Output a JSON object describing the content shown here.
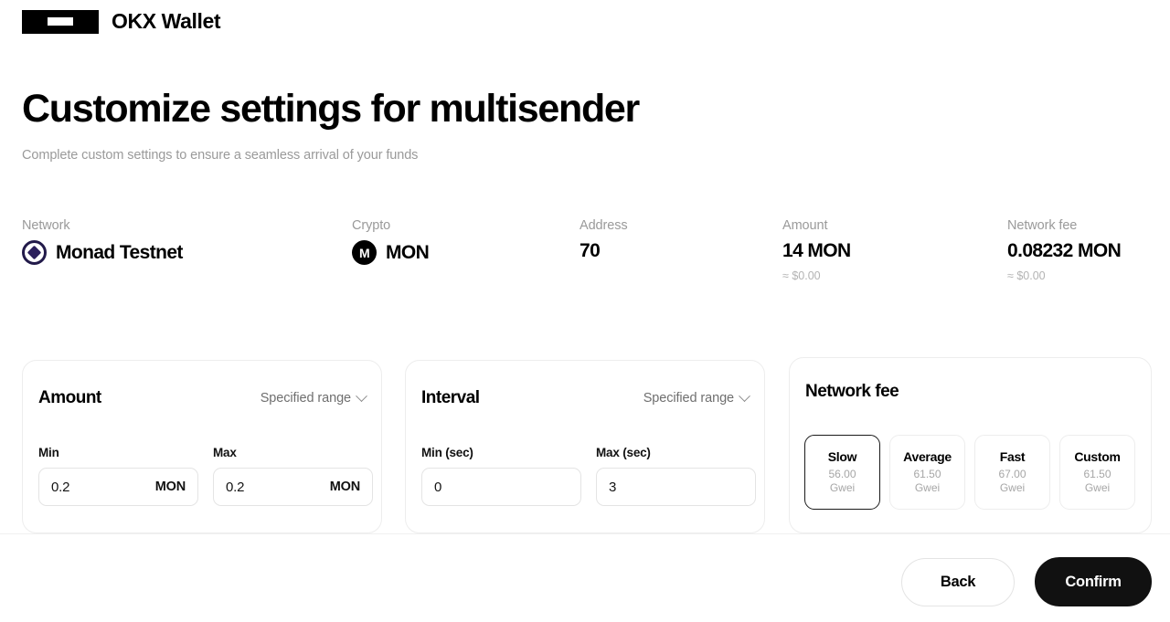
{
  "header": {
    "logo_icon": "okx-logo-icon",
    "brand": "OKX Wallet"
  },
  "page": {
    "title": "Customize settings for multisender",
    "subtitle": "Complete custom settings to ensure a seamless arrival of your funds"
  },
  "summary": {
    "network": {
      "label": "Network",
      "value": "Monad Testnet",
      "icon": "monad-icon"
    },
    "crypto": {
      "label": "Crypto",
      "value": "MON",
      "icon": "mon-token-icon"
    },
    "address": {
      "label": "Address",
      "value": "70"
    },
    "amount": {
      "label": "Amount",
      "value": "14 MON",
      "sub": "≈ $0.00"
    },
    "fee": {
      "label": "Network fee",
      "value": "0.08232 MON",
      "sub": "≈ $0.00"
    }
  },
  "amount_card": {
    "title": "Amount",
    "mode": "Specified range",
    "min": {
      "label": "Min",
      "value": "0.2",
      "suffix": "MON"
    },
    "max": {
      "label": "Max",
      "value": "0.2",
      "suffix": "MON"
    }
  },
  "interval_card": {
    "title": "Interval",
    "mode": "Specified range",
    "min": {
      "label": "Min (sec)",
      "value": "0"
    },
    "max": {
      "label": "Max (sec)",
      "value": "3"
    }
  },
  "fee_card": {
    "title": "Network fee",
    "options": [
      {
        "name": "Slow",
        "value": "56.00",
        "unit": "Gwei",
        "selected": true
      },
      {
        "name": "Average",
        "value": "61.50",
        "unit": "Gwei",
        "selected": false
      },
      {
        "name": "Fast",
        "value": "67.00",
        "unit": "Gwei",
        "selected": false
      },
      {
        "name": "Custom",
        "value": "61.50",
        "unit": "Gwei",
        "selected": false
      }
    ]
  },
  "footer": {
    "back": "Back",
    "confirm": "Confirm"
  },
  "colors": {
    "accent_dark": "#111111",
    "muted": "#9a9a9a",
    "border": "#ededed",
    "monad": "#2b1f5c"
  }
}
